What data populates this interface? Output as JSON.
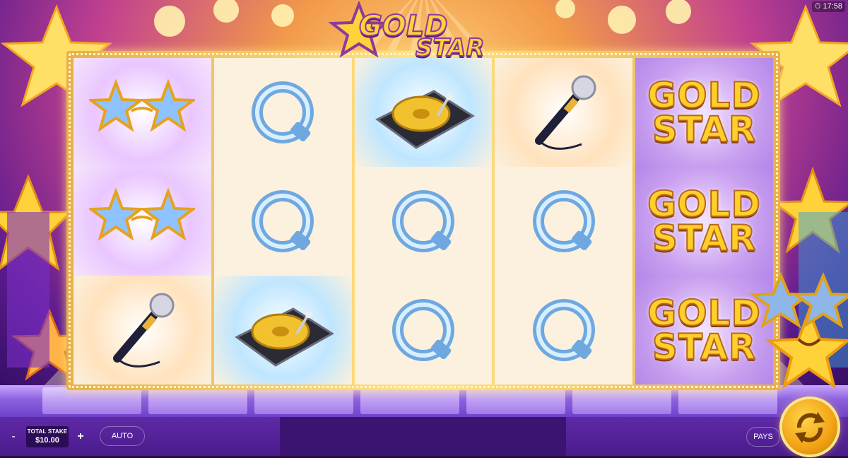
{
  "game": {
    "title_line1": "GOLD",
    "title_line2": "STAR",
    "clock": "17:58"
  },
  "reels": [
    {
      "symbols": [
        {
          "name": "star-glasses-symbol"
        },
        {
          "name": "star-glasses-symbol"
        },
        {
          "name": "microphone-symbol"
        }
      ]
    },
    {
      "symbols": [
        {
          "name": "ring-symbol"
        },
        {
          "name": "ring-symbol"
        },
        {
          "name": "turntable-symbol"
        }
      ]
    },
    {
      "symbols": [
        {
          "name": "turntable-symbol"
        },
        {
          "name": "ring-symbol"
        },
        {
          "name": "ring-symbol"
        }
      ]
    },
    {
      "symbols": [
        {
          "name": "microphone-symbol"
        },
        {
          "name": "ring-symbol"
        },
        {
          "name": "ring-symbol"
        }
      ]
    },
    {
      "symbols": [
        {
          "name": "gold-star-wild-symbol",
          "line1": "GOLD",
          "line2": "STAR"
        },
        {
          "name": "gold-star-wild-symbol",
          "line1": "GOLD",
          "line2": "STAR"
        },
        {
          "name": "gold-star-wild-symbol",
          "line1": "GOLD",
          "line2": "STAR"
        }
      ]
    }
  ],
  "controls": {
    "minus_label": "-",
    "plus_label": "+",
    "stake_label": "TOTAL STAKE",
    "stake_value": "$10.00",
    "auto_label": "AUTO",
    "pays_label": "PAYS"
  },
  "colors": {
    "bar_bg": "#5f2aa6",
    "gold": "#ffcf2a",
    "spin_button": "#f2a214"
  }
}
